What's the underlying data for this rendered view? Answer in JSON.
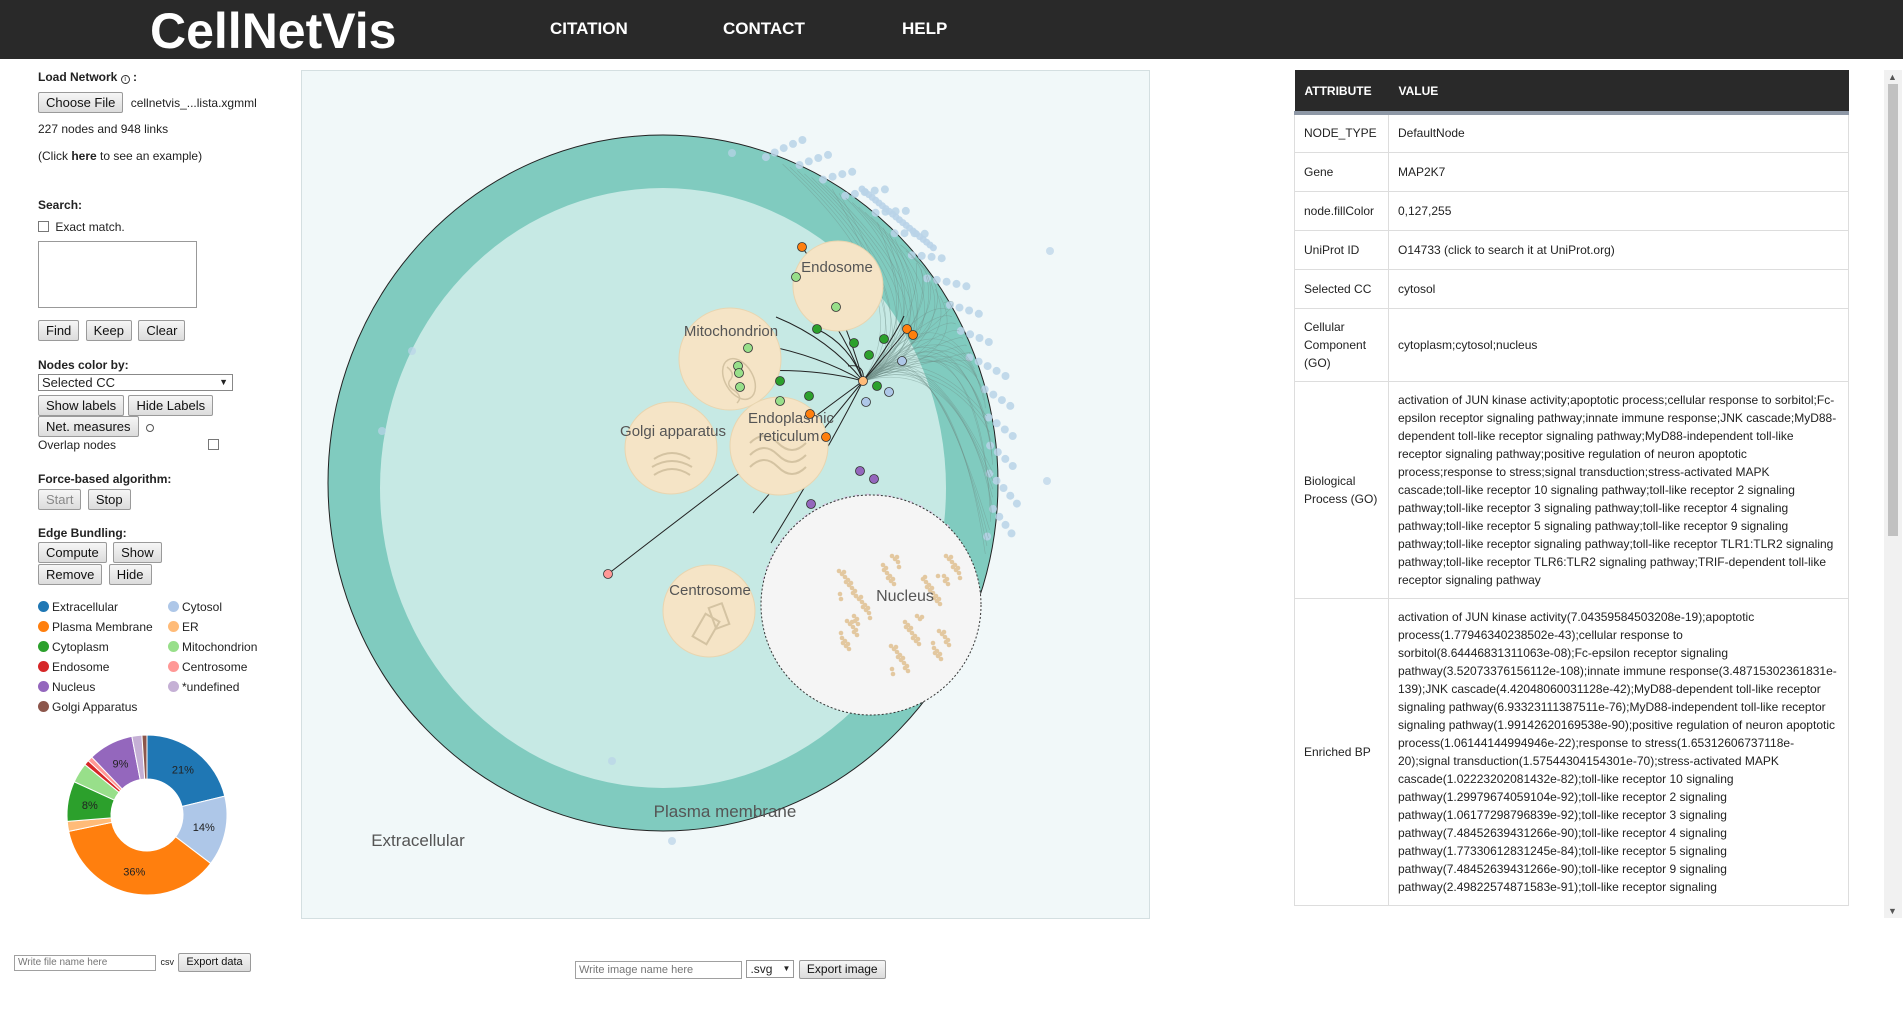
{
  "header": {
    "logo": "CellNetVis",
    "nav": [
      "CITATION",
      "CONTACT",
      "HELP"
    ]
  },
  "left": {
    "load_label": "Load Network",
    "info_icon": "info-circle-icon",
    "colon": ":",
    "choose_file": "Choose File",
    "file_name": "cellnetvis_...lista.xgmml",
    "stats": "227 nodes  and 948 links",
    "example_pre": "(Click ",
    "example_link": "here",
    "example_post": " to see an example)",
    "search_label": "Search:",
    "exact_match": "Exact match.",
    "find": "Find",
    "keep": "Keep",
    "clear": "Clear",
    "color_by_label": "Nodes color by:",
    "color_by_value": "Selected CC",
    "show_labels": "Show labels",
    "hide_labels": "Hide Labels",
    "net_measures": "Net. measures",
    "overlap_nodes": "Overlap nodes",
    "force_label": "Force-based algorithm:",
    "start": "Start",
    "stop": "Stop",
    "bundling_label": "Edge Bundling:",
    "compute": "Compute",
    "show": "Show",
    "remove": "Remove",
    "hide": "Hide",
    "legend": [
      {
        "name": "Extracellular",
        "color": "#1f77b4"
      },
      {
        "name": "Cytosol",
        "color": "#aec7e8"
      },
      {
        "name": "Plasma Membrane",
        "color": "#ff7f0e"
      },
      {
        "name": "ER",
        "color": "#ffbb78"
      },
      {
        "name": "Cytoplasm",
        "color": "#2ca02c"
      },
      {
        "name": "Mitochondrion",
        "color": "#98df8a"
      },
      {
        "name": "Endosome",
        "color": "#d62728"
      },
      {
        "name": "Centrosome",
        "color": "#ff9896"
      },
      {
        "name": "Nucleus",
        "color": "#9467bd"
      },
      {
        "name": "*undefined",
        "color": "#c5b0d5"
      },
      {
        "name": "Golgi Apparatus",
        "color": "#8c564b"
      }
    ]
  },
  "chart_data": {
    "type": "pie",
    "labels": [
      "Extracellular",
      "Cytosol",
      "Plasma Membrane",
      "ER",
      "Cytoplasm",
      "Mitochondrion",
      "Endosome",
      "Centrosome",
      "Nucleus",
      "*undefined",
      "Golgi Apparatus"
    ],
    "values": [
      21,
      14,
      36,
      2,
      8,
      4,
      1,
      1,
      9,
      2,
      1
    ],
    "data_labels": [
      "21%",
      "14%",
      "36%",
      "",
      "8%",
      "",
      "",
      "",
      "9%",
      "",
      ""
    ],
    "colors": [
      "#1f77b4",
      "#aec7e8",
      "#ff7f0e",
      "#ffbb78",
      "#2ca02c",
      "#98df8a",
      "#d62728",
      "#ff9896",
      "#9467bd",
      "#c5b0d5",
      "#8c564b"
    ]
  },
  "canvas": {
    "compartments": [
      "Extracellular",
      "Plasma membrane",
      "Endosome",
      "Mitochondrion",
      "Golgi apparatus",
      "Endoplasmic reticulum",
      "Centrosome",
      "Nucleus"
    ]
  },
  "attributes": {
    "col_attribute": "ATTRIBUTE",
    "col_value": "VALUE",
    "rows": [
      {
        "k": "NODE_TYPE",
        "v": "DefaultNode"
      },
      {
        "k": "Gene",
        "v": "MAP2K7"
      },
      {
        "k": "node.fillColor",
        "v": "0,127,255"
      },
      {
        "k": "UniProt ID",
        "v": "O14733 (click to search it at UniProt.org)"
      },
      {
        "k": "Selected CC",
        "v": "cytosol"
      },
      {
        "k": "Cellular Component (GO)",
        "v": "cytoplasm;cytosol;nucleus"
      },
      {
        "k": "Biological Process (GO)",
        "v": "activation of JUN kinase activity;apoptotic process;cellular response to sorbitol;Fc-epsilon receptor signaling pathway;innate immune response;JNK cascade;MyD88-dependent toll-like receptor signaling pathway;MyD88-independent toll-like receptor signaling pathway;positive regulation of neuron apoptotic process;response to stress;signal transduction;stress-activated MAPK cascade;toll-like receptor 10 signaling pathway;toll-like receptor 2 signaling pathway;toll-like receptor 3 signaling pathway;toll-like receptor 4 signaling pathway;toll-like receptor 5 signaling pathway;toll-like receptor 9 signaling pathway;toll-like receptor signaling pathway;toll-like receptor TLR1:TLR2 signaling pathway;toll-like receptor TLR6:TLR2 signaling pathway;TRIF-dependent toll-like receptor signaling pathway"
      },
      {
        "k": "Enriched BP",
        "v": "activation of JUN kinase activity(7.04359584503208e-19);apoptotic process(1.77946340238502e-43);cellular response to sorbitol(8.64446831311063e-08);Fc-epsilon receptor signaling pathway(3.52073376156112e-108);innate immune response(3.48715302361831e-139);JNK cascade(4.42048060031128e-42);MyD88-dependent toll-like receptor signaling pathway(6.93323111387511e-76);MyD88-independent toll-like receptor signaling pathway(1.99142620169538e-90);positive regulation of neuron apoptotic process(1.06144144994946e-22);response to stress(1.65312606737118e-20);signal transduction(1.57544304154301e-70);stress-activated MAPK cascade(1.02223202081432e-82);toll-like receptor 10 signaling pathway(1.29979674059104e-92);toll-like receptor 2 signaling pathway(1.06177298796839e-92);toll-like receptor 3 signaling pathway(7.48452639431266e-90);toll-like receptor 4 signaling pathway(1.77330612831245e-84);toll-like receptor 5 signaling pathway(7.48452639431266e-90);toll-like receptor 9 signaling pathway(2.49822574871583e-91);toll-like receptor signaling"
      }
    ]
  },
  "bottom": {
    "data_name_placeholder": "Write file name here",
    "csv": "csv",
    "export_data": "Export data",
    "image_name_placeholder": "Write image name here",
    "format": ".svg",
    "export_image": "Export image"
  }
}
